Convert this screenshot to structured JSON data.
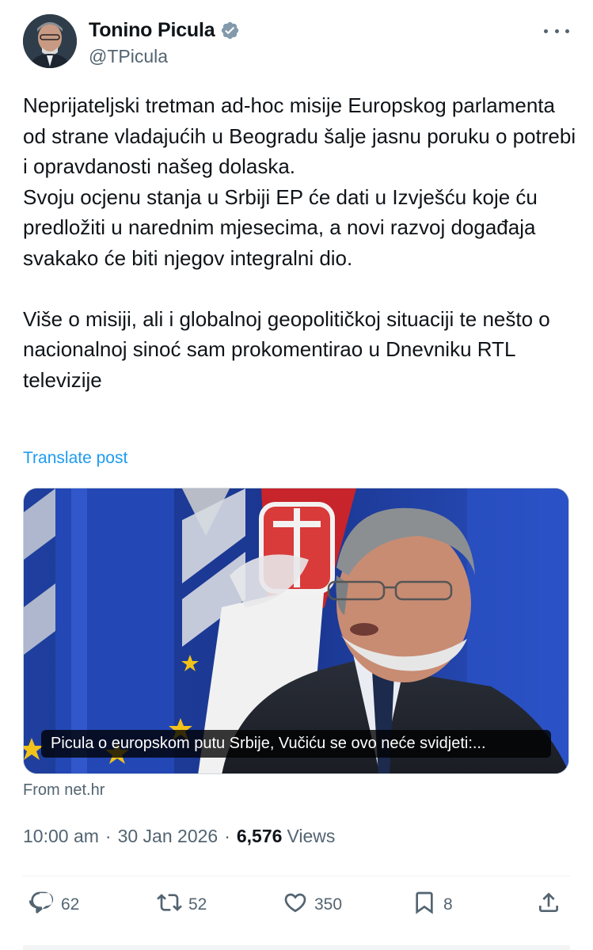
{
  "author": {
    "name": "Tonino Picula",
    "handle": "@TPicula",
    "verified_color": "#829aab"
  },
  "tweet": {
    "text": "Neprijateljski tretman ad-hoc misije Europskog parlamenta od strane vladajućih u Beogradu šalje jasnu poruku o potrebi i opravdanosti našeg dolaska.\nSvoju ocjenu stanja u Srbiji EP će dati u Izvješću koje ću predložiti u narednim mjesecima, a novi razvoj događaja svakako će biti njegov integralni dio.\n\nViše o misiji, ali i globalnoj geopolitičkoj situaciji te nešto o nacionalnoj sinoć sam prokomentirao u Dnevniku RTL televizije",
    "translate_label": "Translate post"
  },
  "media": {
    "caption": "Picula o europskom putu Srbije, Vučiću se ovo neće svidjeti:...",
    "source": "From net.hr"
  },
  "meta": {
    "time": "10:00 am",
    "date": "30 Jan 2026",
    "views_count": "6,576",
    "views_label": "Views",
    "separator": "·"
  },
  "actions": {
    "replies": "62",
    "reposts": "52",
    "likes": "350",
    "bookmarks": "8"
  },
  "colors": {
    "accent": "#1d9bf0",
    "secondary_text": "#536471"
  }
}
